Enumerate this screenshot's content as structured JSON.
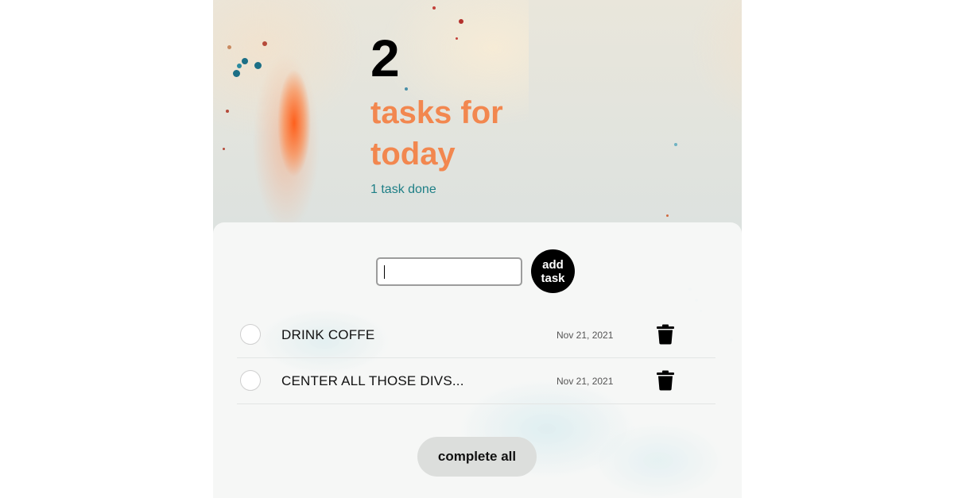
{
  "header": {
    "task_count": "2",
    "subtitle": "tasks for today",
    "done_text": "1 task done"
  },
  "add_task": {
    "input_value": "",
    "button_label": "add task"
  },
  "tasks": [
    {
      "label": "DRINK COFFE",
      "date": "Nov 21, 2021",
      "completed": false
    },
    {
      "label": "CENTER ALL THOSE DIVS...",
      "date": "Nov 21, 2021",
      "completed": false
    }
  ],
  "footer": {
    "complete_all_label": "complete all"
  },
  "icons": {
    "delete": "trash-icon",
    "check": "circle-checkbox-icon"
  },
  "colors": {
    "accent": "#f2874f",
    "done_text": "#1e7f86",
    "button_dark": "#000000",
    "button_light": "#dcdedc"
  }
}
